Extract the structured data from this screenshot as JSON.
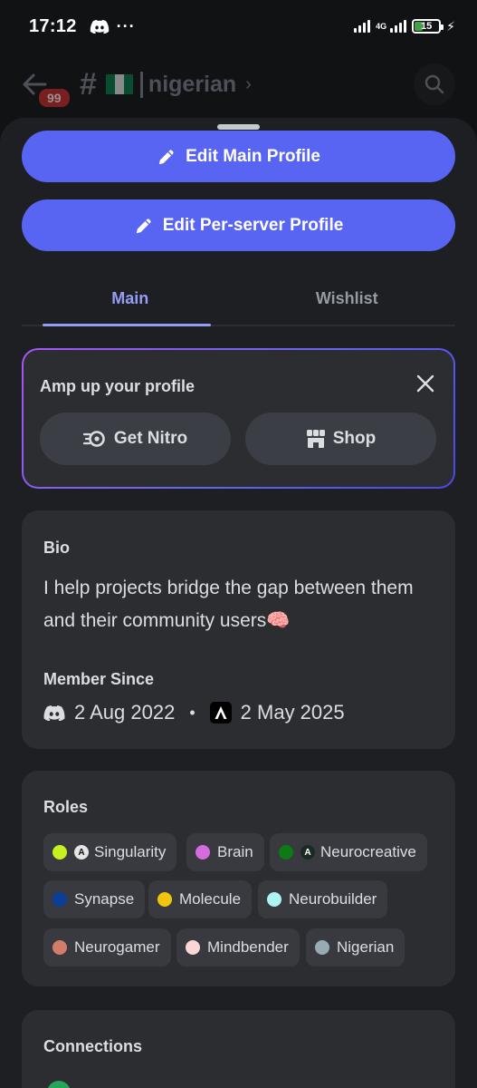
{
  "status_bar": {
    "time": "17:12",
    "dots": "···",
    "network": "4G",
    "battery": "15"
  },
  "channel_header": {
    "notification_count": "99",
    "channel_name": "nigerian"
  },
  "actions": {
    "edit_main_profile": "Edit Main Profile",
    "edit_per_server_profile": "Edit Per-server Profile"
  },
  "tabs": [
    {
      "label": "Main",
      "selected": true
    },
    {
      "label": "Wishlist",
      "selected": false
    }
  ],
  "nitro_promo": {
    "title": "Amp up your profile",
    "get_nitro": "Get Nitro",
    "shop": "Shop"
  },
  "bio": {
    "heading": "Bio",
    "text": "I help projects bridge the gap between them and their community users🧠",
    "member_since_heading": "Member Since",
    "discord_date": "2 Aug 2022",
    "separator": "•",
    "server_date": "2 May 2025"
  },
  "roles": {
    "heading": "Roles",
    "items": [
      {
        "name": "Singularity",
        "color": "#c6f01e",
        "emoji": "A"
      },
      {
        "name": "Brain",
        "color": "#d66be0",
        "emoji": ""
      },
      {
        "name": "Neurocreative",
        "color": "#0d7a16",
        "emoji": "A"
      },
      {
        "name": "Synapse",
        "color": "#0c3e96",
        "emoji": ""
      },
      {
        "name": "Molecule",
        "color": "#f1c40f",
        "emoji": ""
      },
      {
        "name": "Neurobuilder",
        "color": "#aef3f3",
        "emoji": ""
      },
      {
        "name": "Neurogamer",
        "color": "#d27d6a",
        "emoji": ""
      },
      {
        "name": "Mindbender",
        "color": "#fcd6d6",
        "emoji": ""
      },
      {
        "name": "Nigerian",
        "color": "#99aab5",
        "emoji": ""
      }
    ]
  },
  "connections": {
    "heading": "Connections"
  },
  "colors": {
    "blurple": "#5865f2",
    "tab_active": "#949cf7",
    "card_bg": "#2b2d31",
    "sheet_bg": "#1e1f22"
  }
}
